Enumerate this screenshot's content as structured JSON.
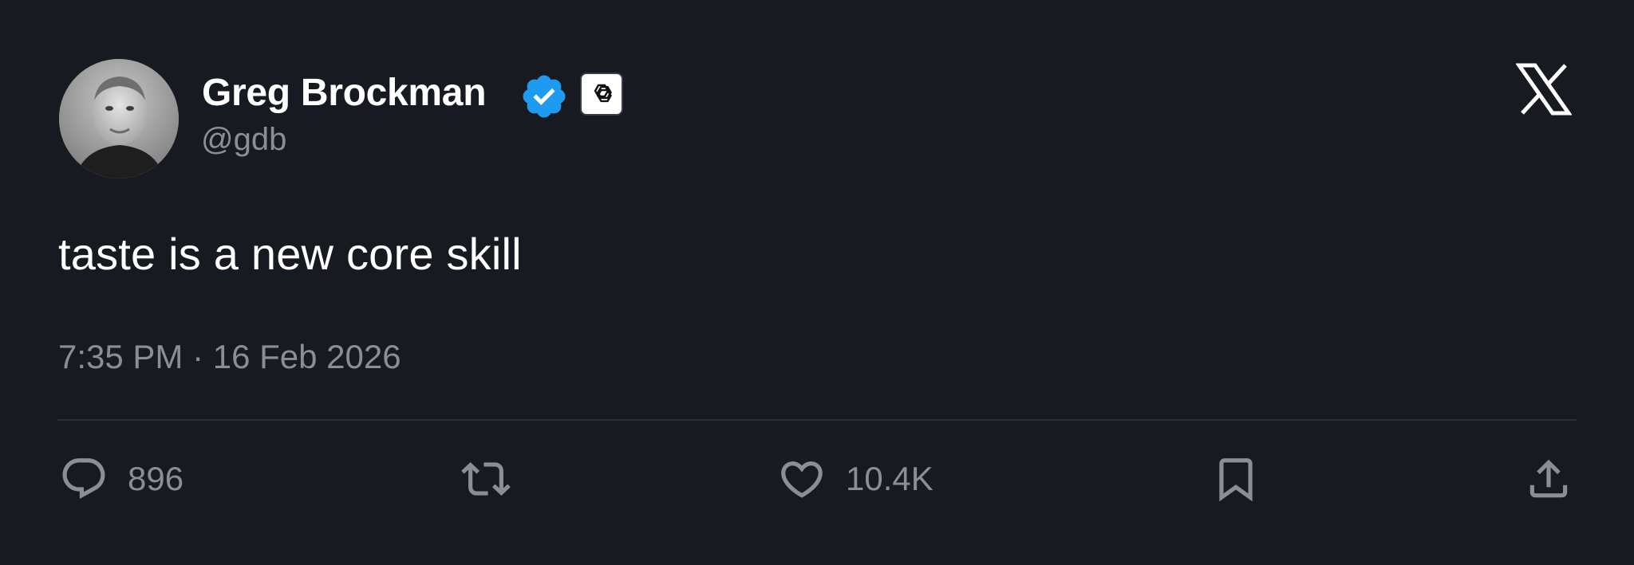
{
  "author": {
    "name": "Greg Brockman",
    "handle": "@gdb",
    "verified": true,
    "affiliation_icon": "openai-logo-icon"
  },
  "tweet": {
    "text": "taste is a new core skill",
    "timestamp": "7:35 PM · 16 Feb 2026"
  },
  "actions": {
    "reply_count": "896",
    "retweet_count": "",
    "like_count": "10.4K"
  },
  "colors": {
    "background": "#181a22",
    "verified_blue": "#1d9bf0",
    "secondary_text": "#8b8e96",
    "primary_text": "#ffffff"
  },
  "icons": [
    "x-logo-icon",
    "verified-badge-icon",
    "openai-logo-icon",
    "reply-icon",
    "retweet-icon",
    "like-icon",
    "bookmark-icon",
    "share-icon"
  ]
}
